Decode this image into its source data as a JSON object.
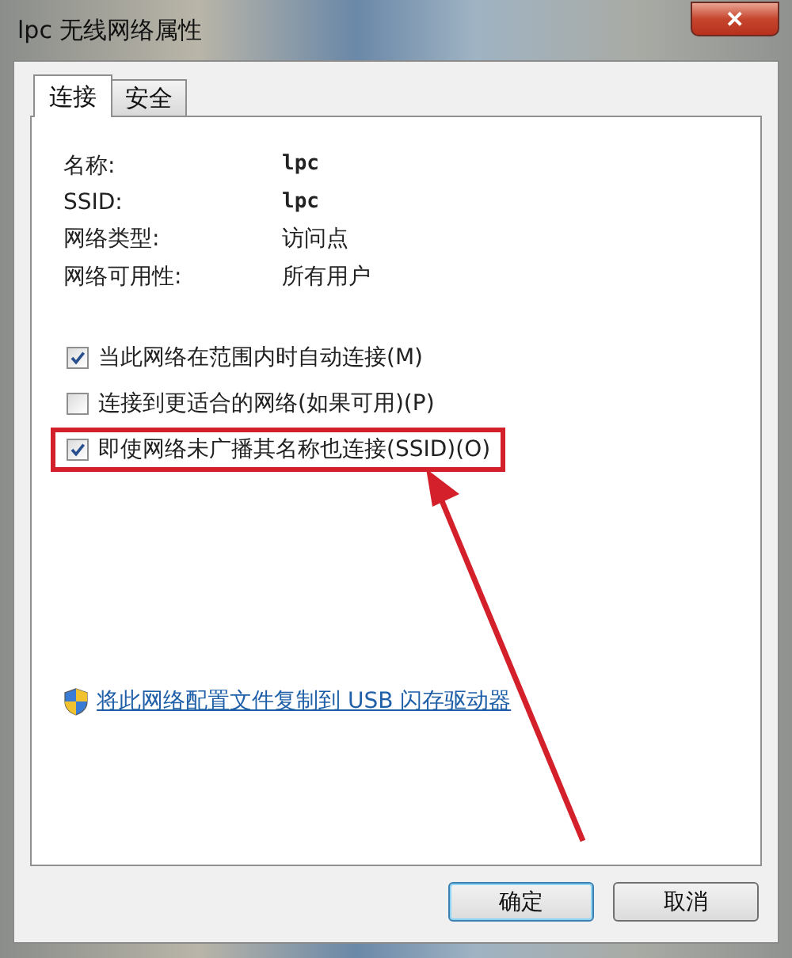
{
  "window": {
    "title": "lpc 无线网络属性",
    "close": "✕"
  },
  "tabs": [
    {
      "label": "连接",
      "selected": true
    },
    {
      "label": "安全",
      "selected": false
    }
  ],
  "properties": [
    {
      "label": "名称:",
      "value": "lpc",
      "mono": true
    },
    {
      "label": "SSID:",
      "value": "lpc",
      "mono": true
    },
    {
      "label": "网络类型:",
      "value": "访问点",
      "mono": false
    },
    {
      "label": "网络可用性:",
      "value": "所有用户",
      "mono": false
    }
  ],
  "options": [
    {
      "label": "当此网络在范围内时自动连接(M)",
      "checked": true,
      "highlighted": false
    },
    {
      "label": "连接到更适合的网络(如果可用)(P)",
      "checked": false,
      "highlighted": false
    },
    {
      "label": "即使网络未广播其名称也连接(SSID)(O)",
      "checked": true,
      "highlighted": true
    }
  ],
  "link": "将此网络配置文件复制到 USB 闪存驱动器",
  "buttons": [
    {
      "label": "确定",
      "default": true
    },
    {
      "label": "取消",
      "default": false
    }
  ]
}
